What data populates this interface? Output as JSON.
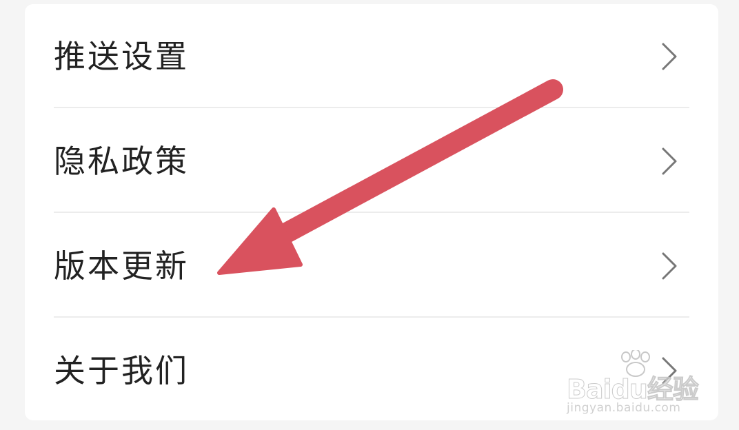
{
  "settings": {
    "items": [
      {
        "label": "推送设置",
        "icon": "chevron-right-icon"
      },
      {
        "label": "隐私政策",
        "icon": "chevron-right-icon"
      },
      {
        "label": "版本更新",
        "icon": "chevron-right-icon"
      },
      {
        "label": "关于我们",
        "icon": "chevron-right-icon"
      }
    ]
  },
  "annotation": {
    "icon": "red-arrow-icon",
    "color": "#d9525e"
  },
  "watermark": {
    "brand": "Baidu经验",
    "url": "jingyan.baidu.com",
    "icon": "paw-icon"
  },
  "colors": {
    "background": "#f5f5f5",
    "card": "#ffffff",
    "text": "#222222",
    "chevron": "#777777",
    "divider": "#ececec"
  }
}
